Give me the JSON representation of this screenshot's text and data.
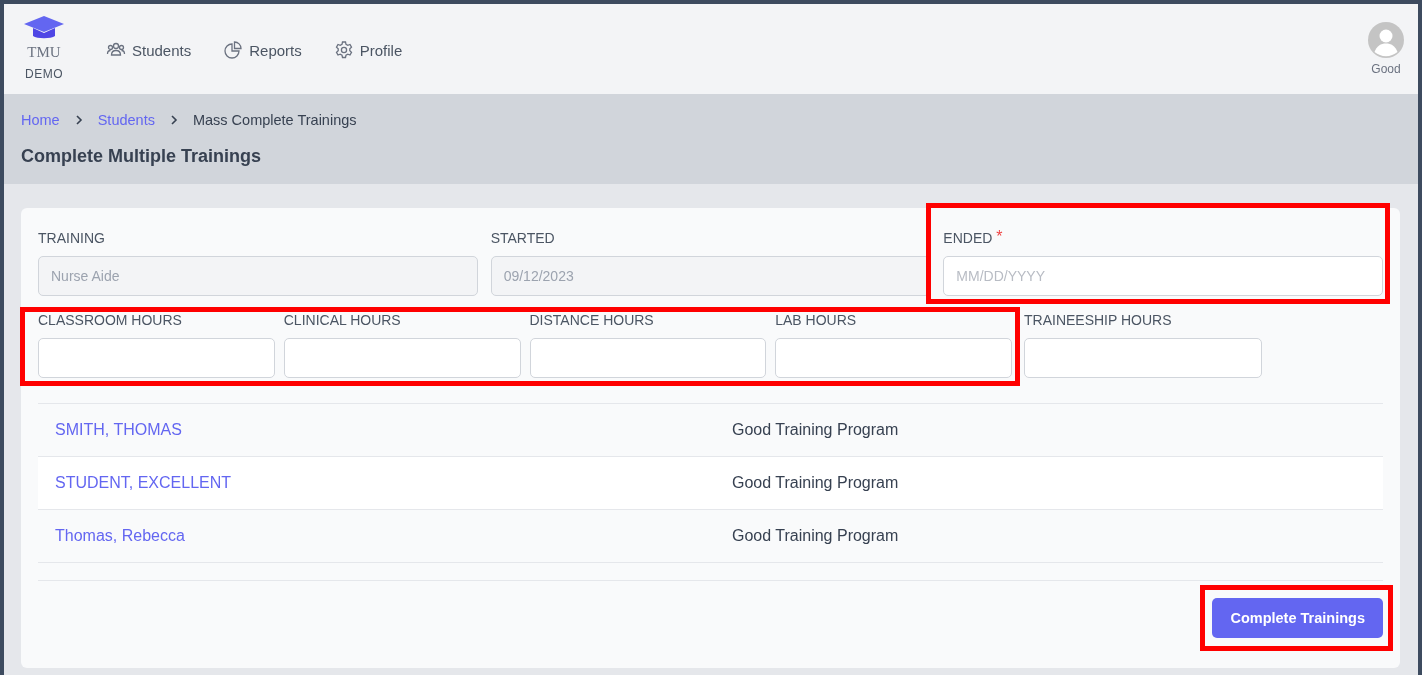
{
  "nav": {
    "logo_text": "TMU",
    "logo_subtext": "DEMO",
    "items": [
      {
        "label": "Students"
      },
      {
        "label": "Reports"
      },
      {
        "label": "Profile"
      }
    ],
    "user": "Good"
  },
  "breadcrumb": [
    {
      "label": "Home",
      "kind": "link"
    },
    {
      "label": "Students",
      "kind": "link"
    },
    {
      "label": "Mass Complete Trainings",
      "kind": "current"
    }
  ],
  "page_title": "Complete Multiple Trainings",
  "fields_top": [
    {
      "label": "TRAINING",
      "value": "Nurse Aide",
      "disabled": true,
      "highlighted": false
    },
    {
      "label": "STARTED",
      "value": "09/12/2023",
      "disabled": true,
      "highlighted": false
    },
    {
      "label": "ENDED",
      "required_mark": "*",
      "placeholder": "MM/DD/YYYY",
      "disabled": false,
      "highlighted": true
    }
  ],
  "hours_group": {
    "highlighted": true,
    "fields": [
      {
        "label": "CLASSROOM HOURS"
      },
      {
        "label": "CLINICAL HOURS"
      },
      {
        "label": "DISTANCE HOURS"
      },
      {
        "label": "LAB HOURS"
      }
    ]
  },
  "extra_field": {
    "label": "TRAINEESHIP HOURS",
    "highlighted": false
  },
  "students": [
    {
      "name": "SMITH, THOMAS",
      "program": "Good Training Program"
    },
    {
      "name": "STUDENT, EXCELLENT",
      "program": "Good Training Program"
    },
    {
      "name": "Thomas, Rebecca",
      "program": "Good Training Program"
    }
  ],
  "submit": {
    "label": "Complete Trainings",
    "highlighted": true
  }
}
